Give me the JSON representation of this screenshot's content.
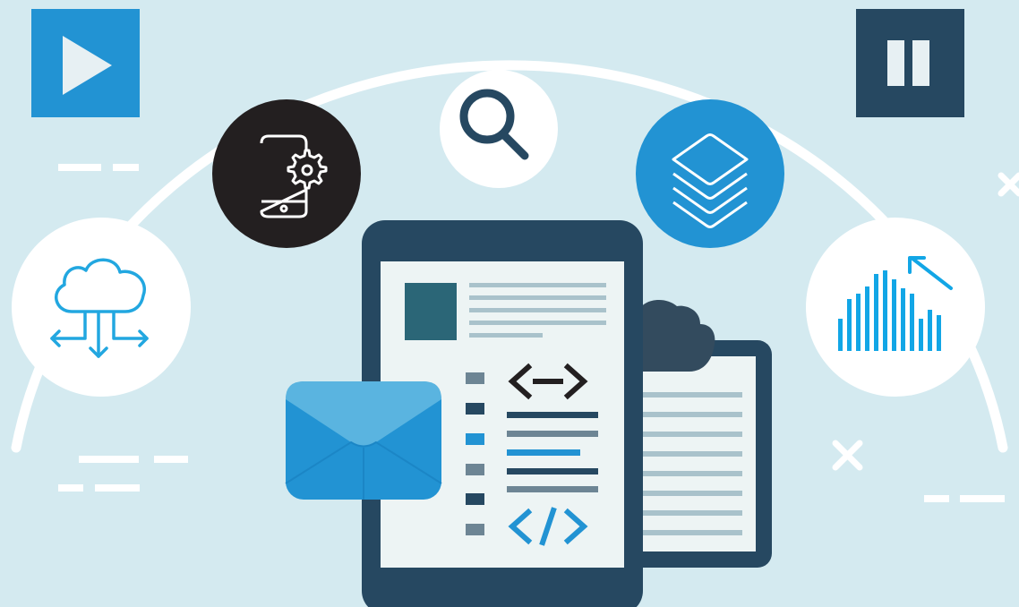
{
  "colors": {
    "background": "#d4eaf0",
    "white": "#ffffff",
    "dark_navy": "#264861",
    "bright_blue": "#2293d3",
    "black_circle": "#231f20",
    "teal_block": "#2b6677",
    "light_line": "#a9c2cb",
    "gray_marker": "#6d8594",
    "screen_bg": "#edf4f4",
    "envelope_top": "#5ab4e0",
    "envelope_body": "#1f95d6",
    "cloud_dark": "#334b5e"
  },
  "icons": {
    "play_button": "play-icon",
    "pause_button": "pause-icon",
    "search": "magnifier-icon",
    "mobile_settings": "phone-gear-icon",
    "layers": "layers-stack-icon",
    "cloud_network": "cloud-distribution-icon",
    "analytics": "bar-chart-arrow-icon",
    "email": "envelope-icon",
    "cloud_doc": "cloud-clipboard-icon",
    "code_dark": "code-arrows-icon",
    "code_blue": "code-slash-icon"
  }
}
